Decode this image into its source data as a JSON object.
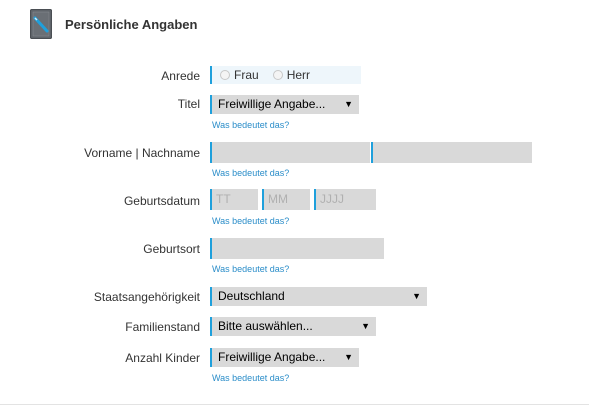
{
  "section": {
    "title": "Persönliche Angaben",
    "icon": "pen-notebook-icon"
  },
  "help_text": "Was bedeutet das?",
  "anrede": {
    "label": "Anrede",
    "options": [
      "Frau",
      "Herr"
    ]
  },
  "titel": {
    "label": "Titel",
    "value": "Freiwillige Angabe..."
  },
  "name": {
    "label": "Vorname | Nachname"
  },
  "geburtsdatum": {
    "label": "Geburtsdatum",
    "day_placeholder": "TT",
    "month_placeholder": "MM",
    "year_placeholder": "JJJJ"
  },
  "geburtsort": {
    "label": "Geburtsort"
  },
  "staatsangehoerigkeit": {
    "label": "Staatsangehörigkeit",
    "value": "Deutschland"
  },
  "familienstand": {
    "label": "Familienstand",
    "value": "Bitte auswählen..."
  },
  "kinder": {
    "label": "Anzahl Kinder",
    "value": "Freiwillige Angabe..."
  },
  "dropdown_arrow": "▼",
  "colors": {
    "accent": "#1fa0dc",
    "field_bg": "#d9d9d9",
    "link": "#2a8dc9"
  }
}
